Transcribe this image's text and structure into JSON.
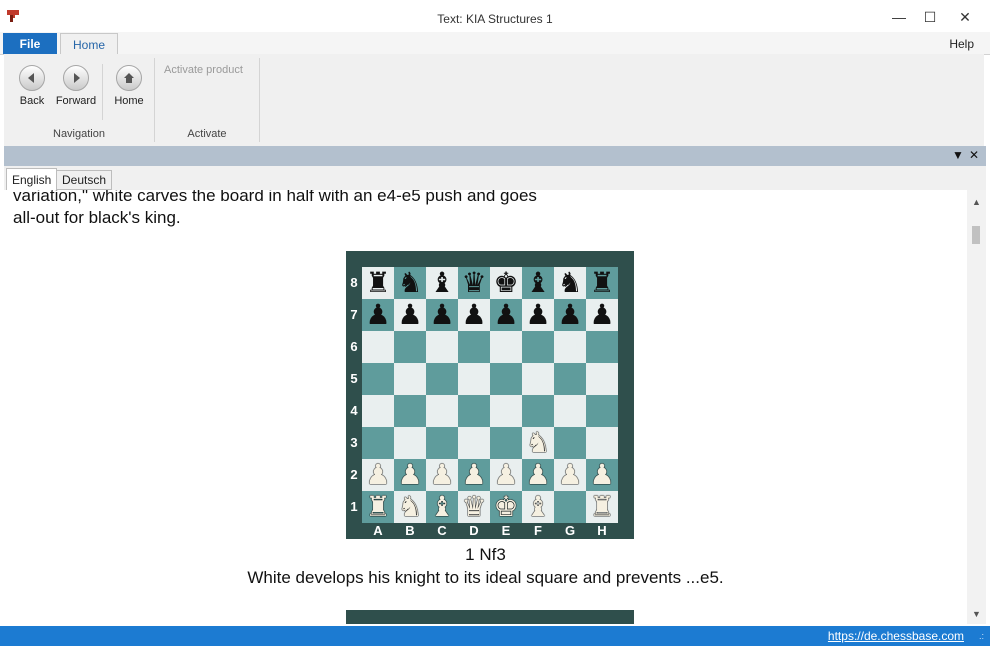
{
  "window": {
    "title": "Text: KIA Structures 1",
    "minimize": "—",
    "maximize": "☐",
    "close": "✕"
  },
  "ribbon": {
    "file_tab": "File",
    "home_tab": "Home",
    "help": "Help",
    "buttons": {
      "back": "Back",
      "forward": "Forward",
      "home": "Home"
    },
    "groups": {
      "navigation": "Navigation",
      "activate": "Activate"
    },
    "activate_product": "Activate product"
  },
  "pane": {
    "dropdown": "▼",
    "close": "✕"
  },
  "languages": [
    "English",
    "Deutsch"
  ],
  "content": {
    "para_line1": "variation,\" white carves the board in half with an e4-e5 push and goes",
    "para_line2": "all-out for black's king.",
    "move": "1 Nf3",
    "comment": "White develops his knight to its ideal square and prevents ...e5."
  },
  "board": {
    "ranks": [
      "8",
      "7",
      "6",
      "5",
      "4",
      "3",
      "2",
      "1"
    ],
    "files": [
      "A",
      "B",
      "C",
      "D",
      "E",
      "F",
      "G",
      "H"
    ],
    "position": [
      "rnbqkbnr",
      "pppppppp",
      "........",
      "........",
      "........",
      ".....N..",
      "PPPPPPPP",
      "RNBQKB.R"
    ],
    "colors": {
      "light": "#e9efef",
      "dark": "#5f9c9c",
      "frame": "#2f4f4c"
    }
  },
  "statusbar": {
    "url": "https://de.chessbase.com",
    "grip": ".:"
  }
}
